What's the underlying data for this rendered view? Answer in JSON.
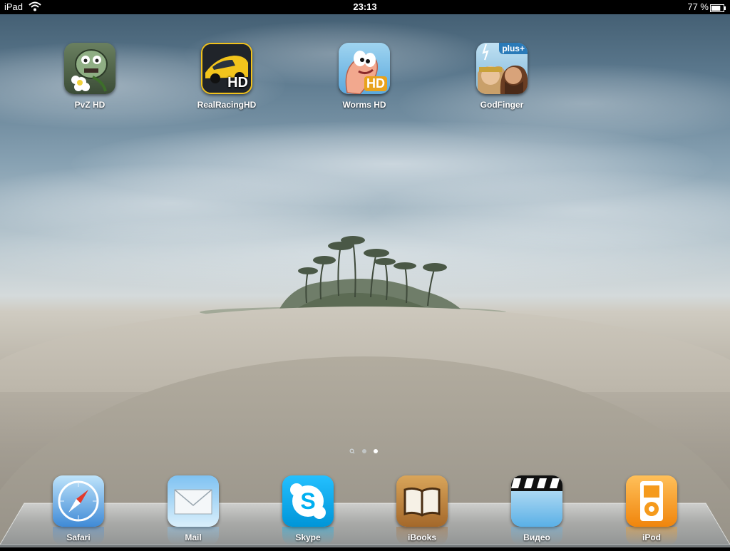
{
  "status_bar": {
    "carrier": "iPad",
    "time": "23:13",
    "battery_percent": "77 %",
    "battery_level": 0.77,
    "wifi_icon": "wifi-icon",
    "battery_icon": "battery-icon"
  },
  "home_apps": [
    {
      "label": "PvZ HD",
      "icon": "plants-vs-zombies-icon"
    },
    {
      "label": "RealRacingHD",
      "icon": "real-racing-icon"
    },
    {
      "label": "Worms HD",
      "icon": "worms-icon"
    },
    {
      "label": "GodFinger",
      "icon": "godfinger-icon"
    }
  ],
  "icon_badges": {
    "racing": "HD",
    "worms": "HD",
    "godfinger": "plus+"
  },
  "page_indicator": {
    "pages": 3,
    "current": 3,
    "first_is_search": true
  },
  "dock_apps": [
    {
      "label": "Safari",
      "icon": "safari-compass-icon"
    },
    {
      "label": "Mail",
      "icon": "mail-envelope-icon"
    },
    {
      "label": "Skype",
      "icon": "skype-icon"
    },
    {
      "label": "iBooks",
      "icon": "ibooks-icon"
    },
    {
      "label": "Видео",
      "icon": "videos-clapperboard-icon"
    },
    {
      "label": "iPod",
      "icon": "ipod-icon"
    }
  ],
  "colors": {
    "status_bar": "#000000",
    "skype": "#00aff0",
    "ipod": "#f59a1c",
    "safari": "#3f8ad6"
  }
}
